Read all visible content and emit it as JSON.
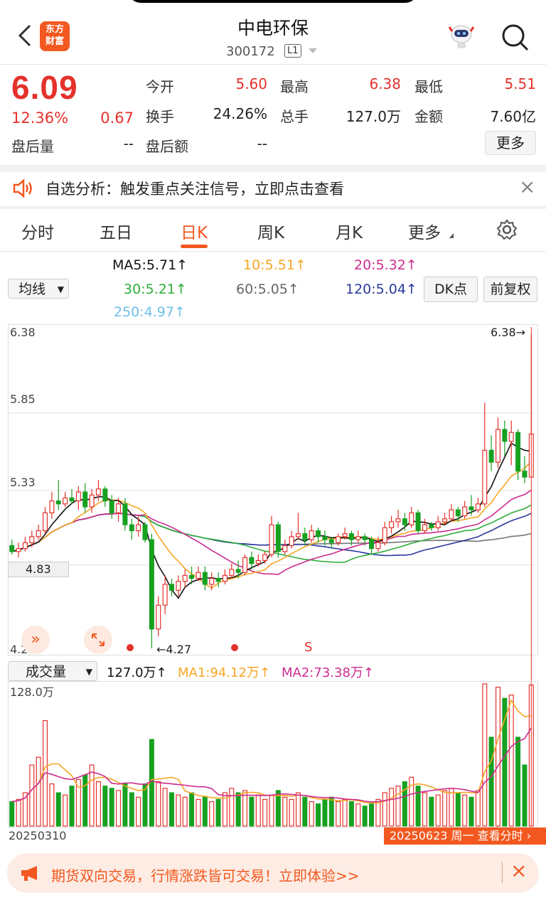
{
  "header": {
    "logo_line1": "东方",
    "logo_line2": "财富",
    "stock_name": "中电环保",
    "stock_code": "300172",
    "level_badge": "L1"
  },
  "quote": {
    "price": "6.09",
    "change_pct": "12.36%",
    "change": "0.67",
    "after_hours_vol_label": "盘后量",
    "after_hours_vol": "--",
    "after_hours_amt_label": "盘后额",
    "after_hours_amt": "--",
    "open_label": "今开",
    "open": "5.60",
    "high_label": "最高",
    "high": "6.38",
    "low_label": "最低",
    "low": "5.51",
    "turnover_label": "换手",
    "turnover": "24.26%",
    "volume_label": "总手",
    "volume": "127.0万",
    "amount_label": "金额",
    "amount": "7.60亿",
    "more_button": "更多"
  },
  "alert": {
    "text": "自选分析：触发重点关注信号，立即点击查看",
    "close": "×"
  },
  "tabs": [
    "分时",
    "五日",
    "日K",
    "周K",
    "月K",
    "更多"
  ],
  "active_tab": "日K",
  "ma_panel": {
    "selector": "均线",
    "ma5": "MA5:5.71↑",
    "ma10": "10:5.51↑",
    "ma20": "20:5.32↑",
    "ma30": "30:5.21↑",
    "ma60": "60:5.05↑",
    "ma120": "120:5.04↑",
    "ma250": "250:4.97↑",
    "dk_button": "DK点",
    "adjust_button": "前复权"
  },
  "colors": {
    "up": "#e4322b",
    "down": "#17a121",
    "accent": "#f2581f",
    "ma5": "#111111",
    "ma10": "#f5a623",
    "ma20": "#cc2c8f",
    "ma30": "#2eae3a",
    "ma60": "#777777",
    "ma120": "#2a3aa0",
    "ma250": "#6fc0ea"
  },
  "chart_data": {
    "type": "candlestick",
    "y_ticks": [
      "6.38",
      "5.85",
      "5.33",
      "4.83",
      "4.27"
    ],
    "ylim": [
      4.27,
      6.38
    ],
    "max_label": "6.38→",
    "min_label": "←4.27",
    "signal_label": "S",
    "start_date": "20250310",
    "end_date": "20250623 周一 查看分时",
    "candles": [
      [
        4.96,
        4.92,
        5.0,
        4.9
      ],
      [
        4.92,
        4.94,
        4.98,
        4.88
      ],
      [
        4.94,
        4.98,
        5.02,
        4.92
      ],
      [
        4.98,
        5.02,
        5.06,
        4.95
      ],
      [
        5.02,
        5.06,
        5.1,
        5.0
      ],
      [
        5.06,
        5.18,
        5.22,
        5.04
      ],
      [
        5.18,
        5.26,
        5.32,
        5.14
      ],
      [
        5.26,
        5.24,
        5.4,
        5.2
      ],
      [
        5.24,
        5.28,
        5.32,
        5.22
      ],
      [
        5.28,
        5.26,
        5.34,
        5.24
      ],
      [
        5.26,
        5.32,
        5.36,
        5.2
      ],
      [
        5.32,
        5.22,
        5.38,
        5.18
      ],
      [
        5.22,
        5.3,
        5.34,
        5.18
      ],
      [
        5.3,
        5.34,
        5.4,
        5.26
      ],
      [
        5.34,
        5.26,
        5.36,
        5.22
      ],
      [
        5.26,
        5.18,
        5.3,
        5.14
      ],
      [
        5.18,
        5.24,
        5.28,
        5.12
      ],
      [
        5.24,
        5.1,
        5.28,
        5.06
      ],
      [
        5.1,
        5.06,
        5.14,
        5.0
      ],
      [
        5.06,
        5.1,
        5.16,
        5.02
      ],
      [
        5.1,
        5.0,
        5.12,
        4.98
      ],
      [
        5.0,
        4.4,
        5.04,
        4.27
      ],
      [
        4.4,
        4.56,
        4.62,
        4.35
      ],
      [
        4.56,
        4.7,
        4.76,
        4.5
      ],
      [
        4.7,
        4.66,
        4.74,
        4.62
      ],
      [
        4.66,
        4.72,
        4.76,
        4.62
      ],
      [
        4.72,
        4.76,
        4.8,
        4.68
      ],
      [
        4.76,
        4.74,
        4.82,
        4.7
      ],
      [
        4.74,
        4.78,
        4.82,
        4.72
      ],
      [
        4.78,
        4.7,
        4.82,
        4.66
      ],
      [
        4.7,
        4.74,
        4.78,
        4.66
      ],
      [
        4.74,
        4.72,
        4.78,
        4.68
      ],
      [
        4.72,
        4.76,
        4.8,
        4.7
      ],
      [
        4.76,
        4.8,
        4.84,
        4.74
      ],
      [
        4.8,
        4.78,
        4.86,
        4.74
      ],
      [
        4.78,
        4.88,
        4.9,
        4.76
      ],
      [
        4.88,
        4.84,
        4.92,
        4.8
      ],
      [
        4.84,
        4.86,
        4.9,
        4.82
      ],
      [
        4.86,
        4.9,
        4.92,
        4.84
      ],
      [
        4.9,
        5.1,
        5.16,
        4.88
      ],
      [
        5.1,
        4.92,
        5.12,
        4.88
      ],
      [
        4.92,
        4.96,
        5.0,
        4.9
      ],
      [
        4.96,
        5.02,
        5.06,
        4.94
      ],
      [
        5.02,
        5.04,
        5.18,
        5.0
      ],
      [
        5.04,
        5.0,
        5.08,
        4.96
      ],
      [
        5.0,
        5.06,
        5.1,
        4.98
      ],
      [
        5.06,
        5.02,
        5.08,
        4.98
      ],
      [
        5.02,
        5.0,
        5.06,
        4.96
      ],
      [
        5.0,
        4.98,
        5.02,
        4.94
      ],
      [
        4.98,
        5.02,
        5.04,
        4.96
      ],
      [
        5.02,
        5.04,
        5.08,
        5.0
      ],
      [
        5.04,
        5.0,
        5.06,
        4.96
      ],
      [
        5.0,
        5.02,
        5.06,
        4.98
      ],
      [
        5.02,
        5.0,
        5.04,
        4.96
      ],
      [
        5.0,
        4.94,
        5.02,
        4.9
      ],
      [
        4.94,
        4.98,
        5.02,
        4.92
      ],
      [
        4.98,
        5.08,
        5.12,
        4.96
      ],
      [
        5.08,
        5.12,
        5.16,
        5.04
      ],
      [
        5.12,
        5.14,
        5.2,
        5.08
      ],
      [
        5.14,
        5.1,
        5.18,
        5.06
      ],
      [
        5.1,
        5.18,
        5.22,
        5.08
      ],
      [
        5.18,
        5.06,
        5.2,
        5.04
      ],
      [
        5.06,
        5.1,
        5.14,
        5.04
      ],
      [
        5.1,
        5.08,
        5.12,
        5.06
      ],
      [
        5.08,
        5.12,
        5.16,
        5.06
      ],
      [
        5.12,
        5.14,
        5.18,
        5.1
      ],
      [
        5.14,
        5.2,
        5.24,
        5.12
      ],
      [
        5.2,
        5.16,
        5.22,
        5.12
      ],
      [
        5.16,
        5.22,
        5.26,
        5.14
      ],
      [
        5.22,
        5.2,
        5.3,
        5.16
      ],
      [
        5.2,
        5.24,
        5.28,
        5.18
      ],
      [
        5.24,
        5.6,
        5.92,
        5.22
      ],
      [
        5.6,
        5.52,
        5.7,
        5.46
      ],
      [
        5.52,
        5.74,
        5.82,
        5.48
      ],
      [
        5.74,
        5.66,
        5.8,
        5.56
      ],
      [
        5.66,
        5.72,
        5.8,
        5.5
      ],
      [
        5.72,
        5.46,
        5.74,
        5.4
      ],
      [
        5.46,
        5.42,
        5.56,
        5.38
      ],
      [
        5.42,
        5.71,
        6.38,
        5.51
      ]
    ],
    "volumes": [
      22,
      24,
      30,
      55,
      62,
      95,
      38,
      30,
      28,
      36,
      42,
      46,
      55,
      40,
      36,
      34,
      32,
      38,
      30,
      26,
      38,
      78,
      40,
      34,
      30,
      28,
      26,
      30,
      24,
      26,
      22,
      24,
      30,
      34,
      30,
      32,
      26,
      28,
      24,
      28,
      32,
      26,
      24,
      30,
      26,
      22,
      20,
      24,
      26,
      22,
      24,
      22,
      20,
      18,
      20,
      24,
      30,
      34,
      36,
      40,
      44,
      36,
      30,
      26,
      28,
      32,
      34,
      30,
      28,
      26,
      32,
      128,
      80,
      125,
      115,
      118,
      80,
      55,
      127
    ],
    "vol_ma1": "MA1:94.12万↑",
    "vol_ma2": "MA2:73.38万↑",
    "vol_current": "127.0万↑",
    "vol_max": "128.0万",
    "volume_selector": "成交量"
  },
  "promo": {
    "text": "期货双向交易，行情涨跌皆可交易！立即体验>>",
    "close": "×"
  }
}
